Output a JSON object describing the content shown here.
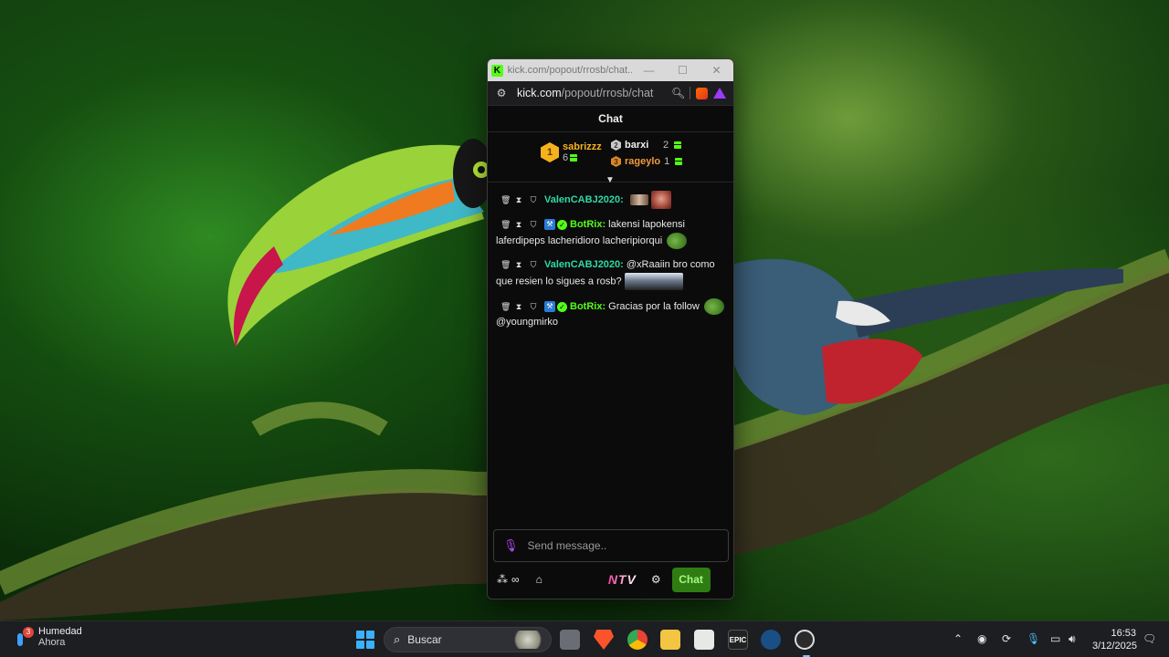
{
  "browser": {
    "tab_title": "kick.com/popout/rrosb/chat...",
    "url_host": "kick.com",
    "url_path": "/popout/rrosb/chat",
    "minimize": "—",
    "maximize": "☐",
    "close": "✕"
  },
  "chat": {
    "header": "Chat",
    "leaderboard": {
      "first": {
        "rank": "1",
        "name": "sabrizzz",
        "count": "6"
      },
      "second": {
        "rank": "2",
        "name": "barxi",
        "count": "2"
      },
      "third": {
        "rank": "3",
        "name": "rageylo",
        "count": "1"
      }
    },
    "messages": [
      {
        "username": "ValenCABJ2020:",
        "text": "",
        "user_color": "#2ed9a3"
      },
      {
        "username": "BotRix:",
        "text": "lakensi lapokensi laferdipeps lacheridioro lacheripiorqui",
        "user_color": "#53fc18"
      },
      {
        "username": "ValenCABJ2020:",
        "text": "@xRaaiin bro como que resien lo sigues a rosb?",
        "user_color": "#2ed9a3"
      },
      {
        "username": "BotRix:",
        "text": "Gracias por la follow",
        "text2": "@youngmirko",
        "user_color": "#53fc18"
      }
    ],
    "input_placeholder": "Send message..",
    "ntv_label": "NTV",
    "chat_button": "Chat"
  },
  "taskbar": {
    "weather_title": "Humedad",
    "weather_sub": "Ahora",
    "weather_badge": "3",
    "search_label": "Buscar",
    "time": "16:53",
    "date": "3/12/2025",
    "epic_label": "EPIC"
  },
  "colors": {
    "kick_green": "#53fc18",
    "gold": "#f6b21d",
    "bronze_name": "#f29a3b"
  }
}
